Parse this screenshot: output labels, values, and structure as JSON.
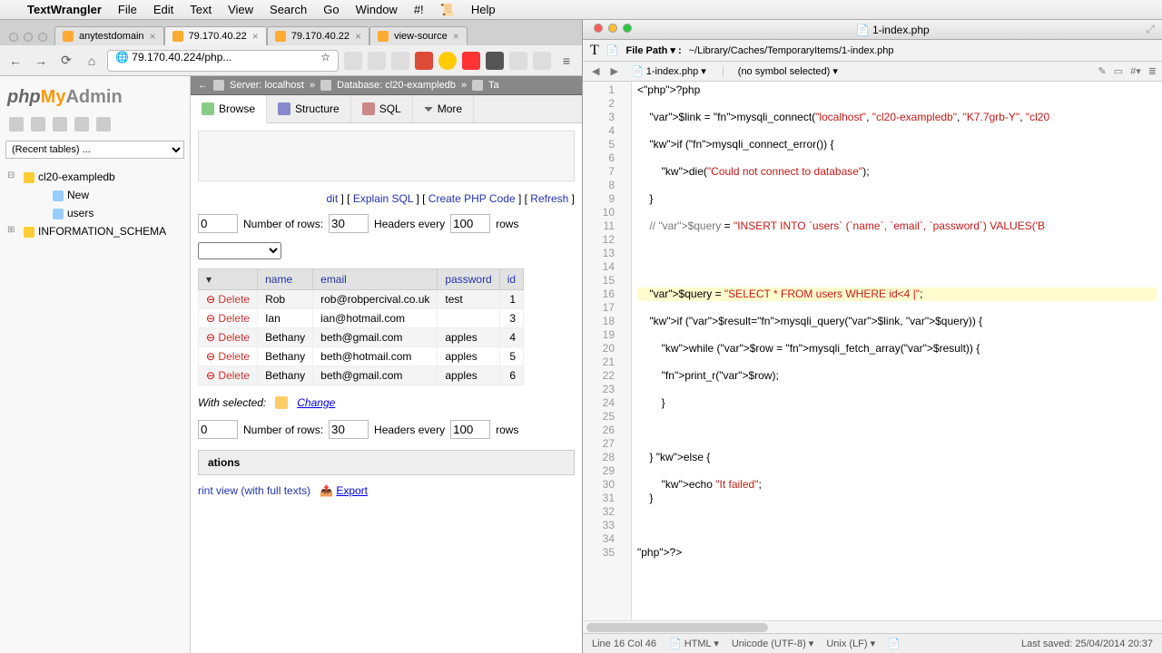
{
  "menubar": {
    "app": "TextWrangler",
    "items": [
      "File",
      "Edit",
      "Text",
      "View",
      "Search",
      "Go",
      "Window",
      "#!",
      "🜂",
      "Help"
    ]
  },
  "browser": {
    "tabs": [
      {
        "label": "anytestdomain",
        "active": false
      },
      {
        "label": "79.170.40.22",
        "active": true
      },
      {
        "label": "79.170.40.22",
        "active": false
      },
      {
        "label": "view-source",
        "active": false
      }
    ],
    "url": "79.170.40.224/php..."
  },
  "pma": {
    "recent_placeholder": "(Recent tables) ...",
    "tree": {
      "db": "cl20-exampledb",
      "children": [
        "New",
        "users"
      ],
      "sibling": "INFORMATION_SCHEMA"
    },
    "breadcrumb": {
      "server": "Server: localhost",
      "database": "Database: cl20-exampledb",
      "tail": "Ta"
    },
    "tabs": {
      "browse": "Browse",
      "structure": "Structure",
      "sql": "SQL",
      "more": "More"
    },
    "links": {
      "edit": "dit",
      "explain": "Explain SQL",
      "create": "Create PHP Code",
      "refresh": "Refresh"
    },
    "pager": {
      "start": "0",
      "rows_label": "Number of rows:",
      "rows": "30",
      "headers_label": "Headers every",
      "headers": "100",
      "trail": "rows"
    },
    "table": {
      "cols": [
        "",
        "name",
        "email",
        "password",
        "id"
      ],
      "rows": [
        {
          "del": "Delete",
          "name": "Rob",
          "email": "rob@robpercival.co.uk",
          "password": "test",
          "id": "1"
        },
        {
          "del": "Delete",
          "name": "Ian",
          "email": "ian@hotmail.com",
          "password": "",
          "id": "3"
        },
        {
          "del": "Delete",
          "name": "Bethany",
          "email": "beth@gmail.com",
          "password": "apples",
          "id": "4"
        },
        {
          "del": "Delete",
          "name": "Bethany",
          "email": "beth@hotmail.com",
          "password": "apples",
          "id": "5"
        },
        {
          "del": "Delete",
          "name": "Bethany",
          "email": "beth@gmail.com",
          "password": "apples",
          "id": "6"
        }
      ]
    },
    "withsel": {
      "label": "With selected:",
      "change": "Change"
    },
    "ops": "ations",
    "export": {
      "print": "rint view (with full texts)",
      "export": "Export"
    }
  },
  "editor": {
    "title": "1-index.php",
    "file_path_label": "File Path ▾ :",
    "file_path": "~/Library/Caches/TemporaryItems/1-index.php",
    "doc": "1-index.php",
    "symbol": "(no symbol selected)",
    "code": [
      "<?php",
      "",
      "    $link = mysqli_connect(\"localhost\", \"cl20-exampledb\", \"K7.7grb-Y\", \"cl20",
      "",
      "    if (mysqli_connect_error()) {",
      "",
      "        die(\"Could not connect to database\");",
      "",
      "    }",
      "",
      "    // $query = \"INSERT INTO `users` (`name`, `email`, `password`) VALUES('B",
      "",
      "",
      "",
      "",
      "    $query = \"SELECT * FROM users WHERE id<4 |\";",
      "",
      "    if ($result=mysqli_query($link, $query)) {",
      "",
      "        while ($row = mysqli_fetch_array($result)) {",
      "",
      "        print_r($row);",
      "",
      "        }",
      "",
      "",
      "",
      "    } else {",
      "",
      "        echo \"It failed\";",
      "    }",
      "",
      "",
      "",
      "?>"
    ],
    "status": {
      "pos": "Line 16 Col 46",
      "lang": "HTML",
      "enc": "Unicode (UTF-8)",
      "le": "Unix (LF)",
      "saved": "Last saved: 25/04/2014 20:37"
    }
  }
}
